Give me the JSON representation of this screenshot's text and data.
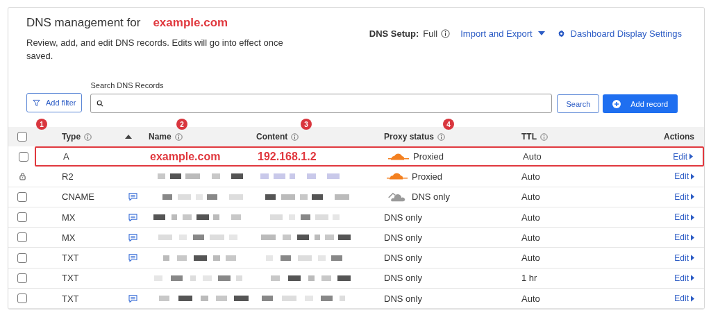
{
  "header": {
    "title": "DNS management for",
    "domain": "example.com",
    "description": "Review, add, and edit DNS records. Edits will go into effect once saved.",
    "dns_setup_label": "DNS Setup:",
    "dns_setup_value": "Full",
    "import_export": "Import and Export",
    "display_settings": "Dashboard Display Settings"
  },
  "toolbar": {
    "add_filter": "Add filter",
    "search_label": "Search DNS Records",
    "search_button": "Search",
    "add_record": "Add record"
  },
  "select_all_checked": false,
  "columns": [
    {
      "label": "Type",
      "badge": "1",
      "info": true,
      "sorted": true
    },
    {
      "label": "Name",
      "badge": "2",
      "info": true,
      "sorted": false
    },
    {
      "label": "Content",
      "badge": "3",
      "info": true,
      "sorted": false
    },
    {
      "label": "Proxy status",
      "badge": "4",
      "info": true,
      "sorted": false
    },
    {
      "label": "TTL",
      "info": true,
      "sorted": false
    },
    {
      "label": "Actions",
      "info": false,
      "sorted": false
    }
  ],
  "rows": [
    {
      "locked": false,
      "checked": false,
      "type": "A",
      "comment": false,
      "redacted": false,
      "name": "example.com",
      "content": "192.168.1.2",
      "cloud_icon": true,
      "proxied": true,
      "proxy": "Proxied",
      "ttl": "Auto",
      "action": "Edit",
      "highlighted": true
    },
    {
      "locked": true,
      "type": "R2",
      "comment": false,
      "redacted": true,
      "cloud_icon": true,
      "proxied": true,
      "proxy": "Proxied",
      "ttl": "Auto",
      "action": "Edit",
      "highlighted": false
    },
    {
      "locked": false,
      "checked": false,
      "type": "CNAME",
      "comment": true,
      "redacted": true,
      "cloud_icon": true,
      "proxied": false,
      "proxy": "DNS only",
      "ttl": "Auto",
      "action": "Edit",
      "highlighted": false
    },
    {
      "locked": false,
      "checked": false,
      "type": "MX",
      "comment": true,
      "redacted": true,
      "cloud_icon": false,
      "proxy": "DNS only",
      "ttl": "Auto",
      "action": "Edit",
      "highlighted": false
    },
    {
      "locked": false,
      "checked": false,
      "type": "MX",
      "comment": true,
      "redacted": true,
      "cloud_icon": false,
      "proxy": "DNS only",
      "ttl": "Auto",
      "action": "Edit",
      "highlighted": false
    },
    {
      "locked": false,
      "checked": false,
      "type": "TXT",
      "comment": true,
      "redacted": true,
      "cloud_icon": false,
      "proxy": "DNS only",
      "ttl": "Auto",
      "action": "Edit",
      "highlighted": false
    },
    {
      "locked": false,
      "checked": false,
      "type": "TXT",
      "comment": false,
      "redacted": true,
      "cloud_icon": false,
      "proxy": "DNS only",
      "ttl": "1 hr",
      "action": "Edit",
      "highlighted": false
    },
    {
      "locked": false,
      "checked": false,
      "type": "TXT",
      "comment": true,
      "redacted": true,
      "cloud_icon": false,
      "proxy": "DNS only",
      "ttl": "Auto",
      "action": "Edit",
      "highlighted": false
    }
  ]
}
